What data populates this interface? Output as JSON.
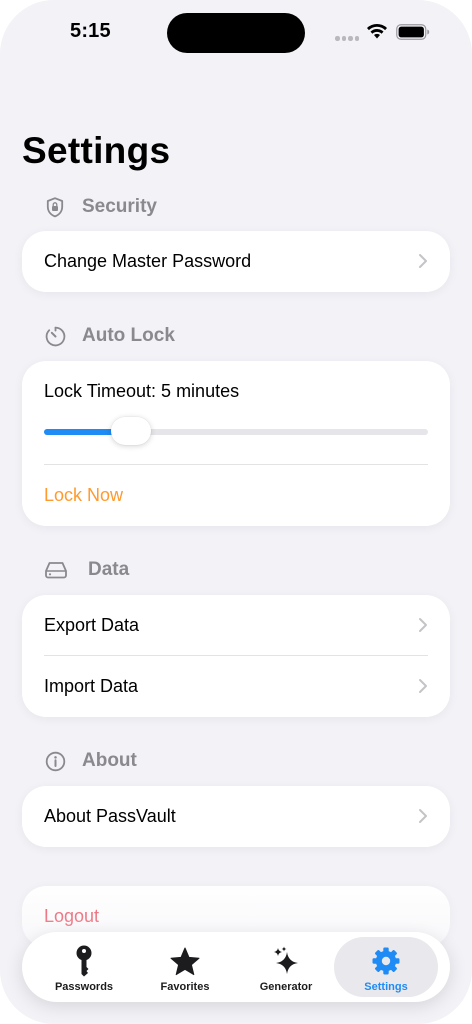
{
  "status_bar": {
    "time": "5:15"
  },
  "page": {
    "title": "Settings"
  },
  "sections": {
    "security": {
      "header": "Security",
      "icon": "shield-lock-icon",
      "items": [
        {
          "label": "Change Master Password"
        }
      ]
    },
    "auto_lock": {
      "header": "Auto Lock",
      "icon": "timer-icon",
      "timeout_label": "Lock Timeout: 5 minutes",
      "slider_value_fraction": 0.18,
      "lock_now_label": "Lock Now"
    },
    "data": {
      "header": "Data",
      "icon": "drive-icon",
      "items": [
        {
          "label": "Export Data"
        },
        {
          "label": "Import Data"
        }
      ]
    },
    "about": {
      "header": "About",
      "icon": "info-circle-icon",
      "items": [
        {
          "label": "About PassVault"
        }
      ]
    }
  },
  "logout": {
    "label": "Logout"
  },
  "tab_bar": {
    "active": "Settings",
    "tabs": [
      {
        "label": "Passwords",
        "icon": "key-icon"
      },
      {
        "label": "Favorites",
        "icon": "star-icon"
      },
      {
        "label": "Generator",
        "icon": "sparkles-icon"
      },
      {
        "label": "Settings",
        "icon": "gear-icon"
      }
    ]
  },
  "colors": {
    "accent": "#1f8bf4",
    "lock_now": "#ff9a2e",
    "logout": "#ec4a5a",
    "background": "#f2f2f7"
  }
}
